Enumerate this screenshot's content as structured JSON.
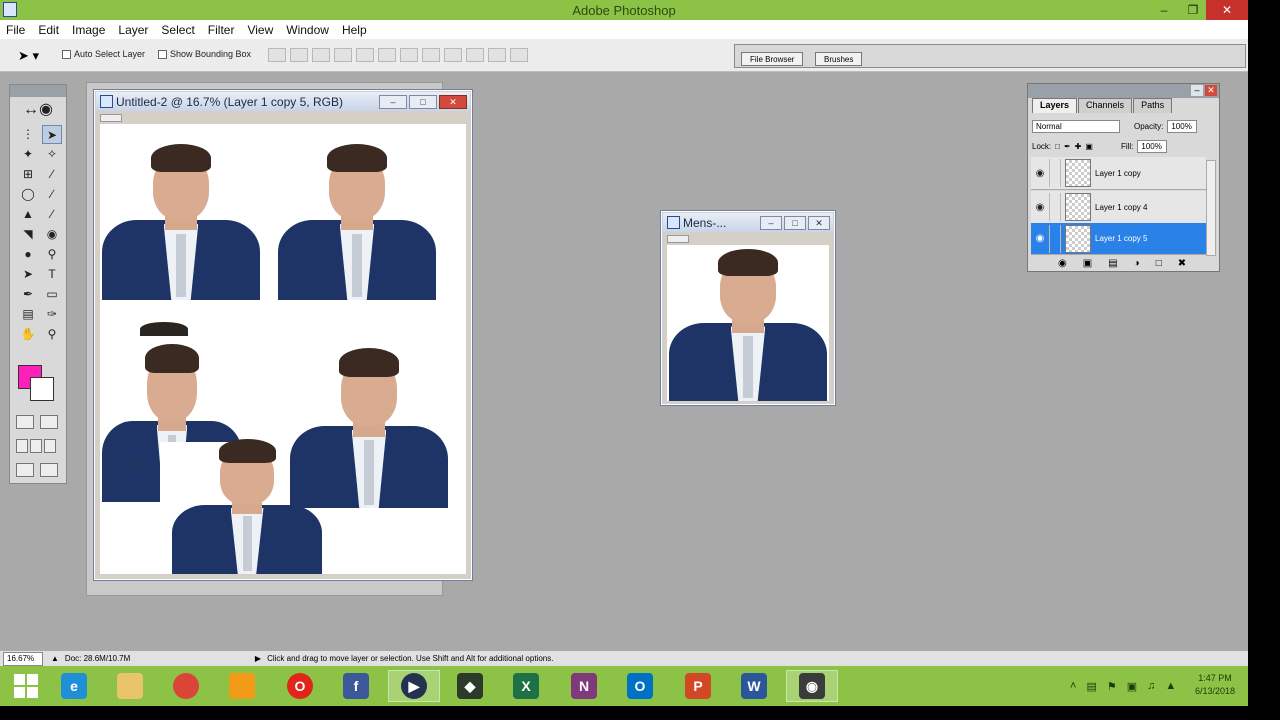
{
  "app": {
    "title": "Adobe Photoshop"
  },
  "menu": [
    "File",
    "Edit",
    "Image",
    "Layer",
    "Select",
    "Filter",
    "View",
    "Window",
    "Help"
  ],
  "options": {
    "auto_select": "Auto Select Layer",
    "show_bounding": "Show Bounding Box",
    "tab_file_browser": "File Browser",
    "tab_brushes": "Brushes"
  },
  "colors": {
    "foreground": "#ff1fba",
    "background": "#ffffff",
    "title_bar": "#8cc346",
    "selected_layer": "#2a82e8"
  },
  "doc_main": {
    "title": "Untitled-2 @ 16.7% (Layer 1 copy 5, RGB)"
  },
  "doc_small": {
    "title": "Mens-..."
  },
  "layers_panel": {
    "tabs": [
      "Layers",
      "Channels",
      "Paths"
    ],
    "blend_mode": "Normal",
    "opacity_label": "Opacity:",
    "opacity_value": "100%",
    "lock_label": "Lock:",
    "fill_label": "Fill:",
    "fill_value": "100%",
    "items": [
      {
        "name": "Layer 1 copy",
        "selected": false
      },
      {
        "name": "Layer 1 copy 4",
        "selected": false
      },
      {
        "name": "Layer 1 copy 5",
        "selected": true
      }
    ]
  },
  "status": {
    "zoom": "16.67%",
    "doc": "Doc: 28.6M/10.7M",
    "hint": "Click and drag to move layer or selection. Use Shift and Alt for additional options."
  },
  "taskbar": {
    "apps": [
      "start",
      "internet-explorer",
      "file-explorer",
      "chrome",
      "uc-browser",
      "opera",
      "facebook",
      "media-player",
      "photoshop-alt",
      "excel",
      "onenote",
      "outlook",
      "powerpoint",
      "word",
      "photoshop"
    ],
    "time": "1:47 PM",
    "date": "6/13/2018"
  }
}
